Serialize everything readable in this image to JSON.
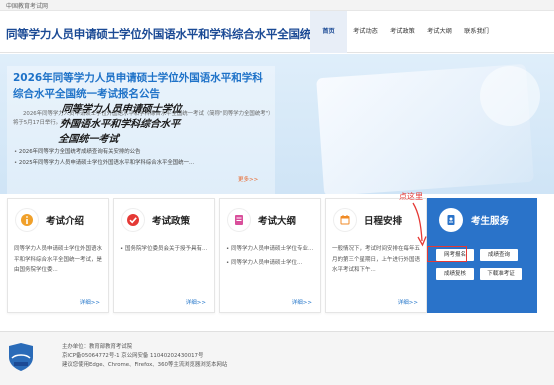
{
  "topbar": {
    "text": "中国教育考试网"
  },
  "header": {
    "title": "同等学力人员申请硕士学位外国语水平和学科综合水平全国统一考试",
    "nav": [
      "首页",
      "考试动态",
      "考试政策",
      "考试大纲",
      "联系我们"
    ]
  },
  "hero": {
    "title": "2026年同等学力人员申请硕士学位外国语水平和学科综合水平全国统一考试报名公告",
    "desc": "2026年同等学力人员申请硕士学位外国语水平和学科综合水平全国统一考试（简称\"同等学力全国统考\"）将于5月17日举行。现将报名...",
    "news": [
      "2026年同等学力全国统考成绩查询有关安排的公告",
      "2025年同等学力人员申请硕士学位外国语水平和学科综合水平全国统一..."
    ],
    "more": "更多>>",
    "big_text": [
      "同等学力人员申请硕士学位",
      "外国语水平和学科综合水平",
      "全国统一考试"
    ]
  },
  "callout": "点这里",
  "cards": [
    {
      "title": "考试介绍",
      "icon": "info-icon",
      "body": [
        "同等学力人员申请硕士学位外国语水平和学科综合水平全国统一考试，是由国务院学位委..."
      ],
      "more": "详细>>"
    },
    {
      "title": "考试政策",
      "icon": "check-icon",
      "items": [
        "国务院学位委员会关于授予具有..."
      ],
      "more": "详细>>"
    },
    {
      "title": "考试大纲",
      "icon": "doc-icon",
      "items": [
        "同等学力人员申请硕士学位专业...",
        "同等学力人员申请硕士学位..."
      ],
      "more": "详细>>"
    },
    {
      "title": "日程安排",
      "icon": "calendar-icon",
      "body": [
        "一般情况下，考试时间安排在每年五月的第三个星期日，上午进行外国语水平考试和下午..."
      ],
      "more": "详细>>"
    }
  ],
  "service": {
    "title": "考生服务",
    "icon": "service-icon",
    "buttons": [
      "网考报名",
      "成绩查询",
      "成绩复核",
      "下载准考证"
    ]
  },
  "footer": {
    "lines": [
      "主办单位：教育部教育考试院",
      "京ICP备05064772号-1    京公网安备 11040202430017号",
      "建议您使用Edge、Chrome、Firefox、360等主流浏览器浏览本网站"
    ]
  },
  "colors": {
    "primary": "#1b4a95",
    "accent": "#2a73c9",
    "highlight": "#e53935",
    "more": "#e8662a"
  }
}
